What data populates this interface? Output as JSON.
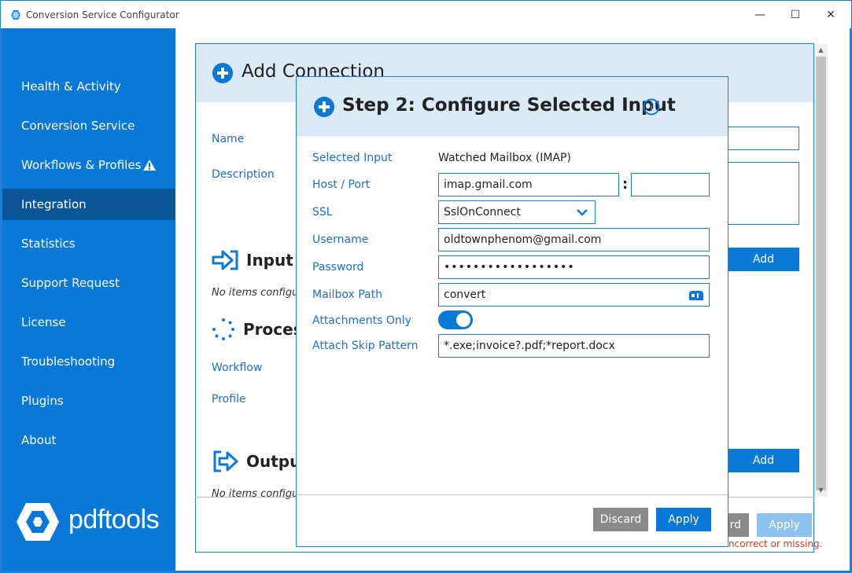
{
  "window": {
    "title": "Conversion Service Configurator",
    "minimize": "—",
    "maximize": "☐",
    "close": "✕"
  },
  "sidebar": {
    "items": [
      {
        "label": "Health & Activity"
      },
      {
        "label": "Conversion Service"
      },
      {
        "label": "Workflows & Profiles"
      },
      {
        "label": "Integration"
      },
      {
        "label": "Statistics"
      },
      {
        "label": "Support Request"
      },
      {
        "label": "License"
      },
      {
        "label": "Troubleshooting"
      },
      {
        "label": "Plugins"
      },
      {
        "label": "About"
      }
    ],
    "active": "Integration",
    "logo_text": "pdftools"
  },
  "background": {
    "title": "Add Connection",
    "name_label": "Name",
    "description_label": "Description",
    "input_section": "Input",
    "input_empty": "No items configu",
    "processing_section": "Process",
    "workflow_label": "Workflow",
    "profile_label": "Profile",
    "output_section": "Output",
    "output_empty": "No items configu",
    "add_label": "Add",
    "discard_partial": "rd",
    "apply_label": "Apply",
    "error_partial": "ncorrect or missing."
  },
  "dialog": {
    "title": "Step 2: Configure Selected Input",
    "selected_input_label": "Selected Input",
    "selected_input_value": "Watched Mailbox (IMAP)",
    "host_port_label": "Host / Port",
    "host_value": "imap.gmail.com",
    "port_value": "",
    "ssl_label": "SSL",
    "ssl_value": "SslOnConnect",
    "username_label": "Username",
    "username_value": "oldtownphenom@gmail.com",
    "password_label": "Password",
    "password_value": "••••••••••••••••••",
    "mailbox_path_label": "Mailbox Path",
    "mailbox_path_value": "convert",
    "attachments_only_label": "Attachments Only",
    "attachments_only_value": true,
    "attach_skip_label": "Attach Skip Pattern",
    "attach_skip_value": "*.exe;invoice?.pdf;*report.docx",
    "discard_label": "Discard",
    "apply_label": "Apply"
  },
  "colors": {
    "accent": "#0a78d7",
    "sidebar_active": "#0b5597",
    "header_bg": "#dceaf7",
    "label": "#1e6fc7",
    "error": "#d04020"
  }
}
